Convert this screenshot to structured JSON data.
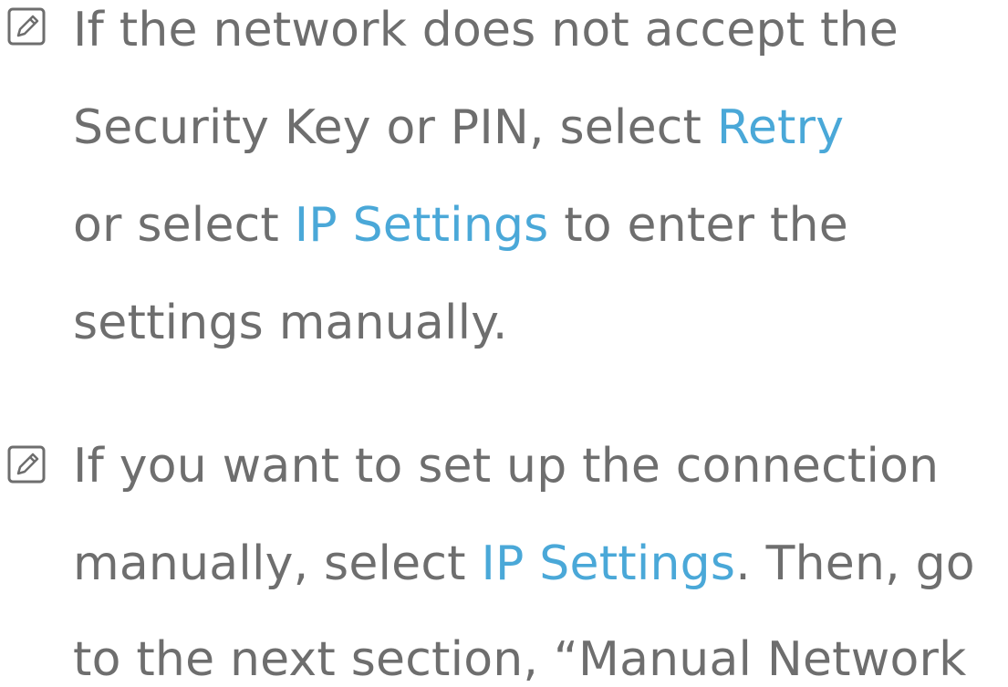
{
  "notes": [
    {
      "icon": "note-pencil-icon",
      "lines": [
        {
          "text": "If the network does not accept the"
        },
        {
          "before": "Security Key or PIN, select ",
          "link": "Retry",
          "after": ""
        },
        {
          "before": "or select ",
          "link": "IP Settings",
          "after": " to enter the"
        },
        {
          "text": "settings manually."
        }
      ]
    },
    {
      "icon": "note-pencil-icon",
      "lines": [
        {
          "text": "If you want to set up the connection"
        },
        {
          "before": "manually, select ",
          "link": "IP Settings",
          "after": ". Then, go"
        },
        {
          "text": "to the next section, “Manual Network"
        }
      ]
    }
  ],
  "colors": {
    "body_text": "#6e6e6e",
    "link": "#4aa8d8"
  }
}
